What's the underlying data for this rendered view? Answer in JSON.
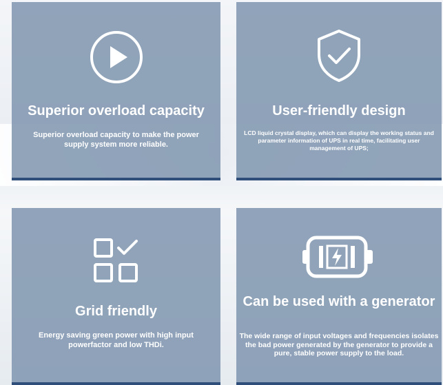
{
  "features": [
    {
      "icon": "play-icon",
      "title": "Superior overload capacity",
      "description": "Superior overload capacity to make the power supply system more reliable."
    },
    {
      "icon": "shield-check-icon",
      "title": "User-friendly design",
      "description": "LCD liquid crystal display, which can display the working status and parameter information of UPS in real time, facilitating user management of UPS;"
    },
    {
      "icon": "grid-check-icon",
      "title": "Grid friendly",
      "description": "Energy saving green power with high input powerfactor and low THDi."
    },
    {
      "icon": "battery-charging-icon",
      "title": "Can be used with a generator",
      "description": "The wide range of input voltages and frequencies isolates the bad power generated by the generator to provide a pure, stable power supply to the load."
    }
  ],
  "colors": {
    "card_background": "#8297b1",
    "card_border": "#2f4f7a",
    "text": "#ffffff"
  }
}
